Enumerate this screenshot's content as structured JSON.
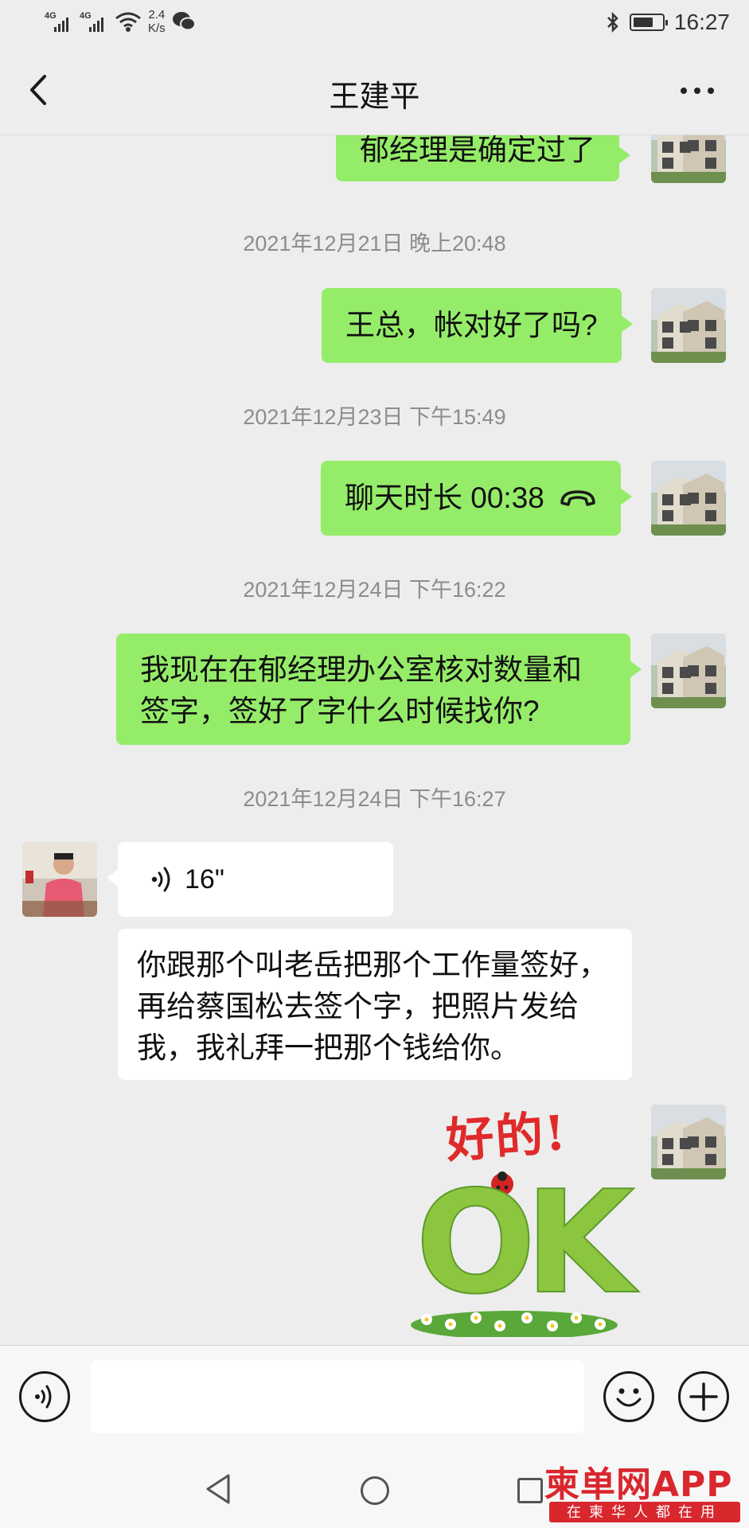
{
  "status_bar": {
    "signal1_label": "4G",
    "signal2_label": "4G",
    "speed_value": "2.4",
    "speed_unit": "K/s",
    "time": "16:27",
    "battery_level": 0.7
  },
  "header": {
    "title": "王建平"
  },
  "chat": {
    "messages": [
      {
        "sender": "me",
        "text": "郁经理是确定过了"
      },
      {
        "timestamp": "2021年12月21日 晚上20:48"
      },
      {
        "sender": "me",
        "text": "王总，帐对好了吗?"
      },
      {
        "timestamp": "2021年12月23日 下午15:49"
      },
      {
        "sender": "me",
        "type": "call",
        "text": "聊天时长 00:38"
      },
      {
        "timestamp": "2021年12月24日 下午16:22"
      },
      {
        "sender": "me",
        "lines": [
          "我现在在郁经理办公室核对数量和",
          "签字，签好了字什么时候找你?"
        ]
      },
      {
        "timestamp": "2021年12月24日 下午16:27"
      },
      {
        "sender": "other",
        "type": "voice",
        "duration": "16\""
      },
      {
        "sender": "other",
        "lines": [
          "你跟那个叫老岳把那个工作量签好，",
          "再给蔡国松去签个字，把照片发给",
          "我，我礼拜一把那个钱给你。"
        ]
      },
      {
        "sender": "me",
        "type": "sticker",
        "sticker_text_top": "好的!",
        "sticker_text_bottom": "OK"
      }
    ]
  },
  "input_bar": {
    "text_value": ""
  },
  "watermark": {
    "title": "柬单网APP",
    "subtitle": "在柬华人都在用"
  },
  "colors": {
    "my_bubble": "#95ec69",
    "other_bubble": "#ffffff",
    "background": "#ededed",
    "watermark_red": "#d9272e"
  }
}
